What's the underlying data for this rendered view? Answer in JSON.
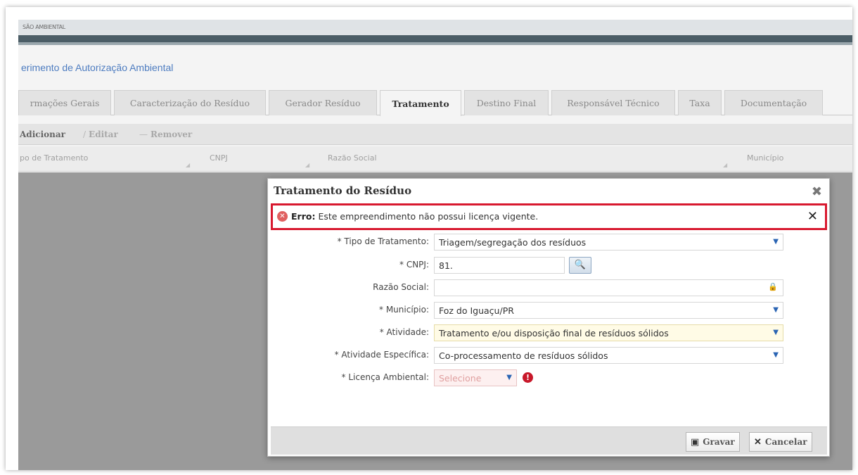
{
  "header": {
    "brand": "SÃO AMBIENTAL",
    "page_title": "erimento de Autorização Ambiental"
  },
  "tabs": [
    {
      "label": "rmações Gerais"
    },
    {
      "label": "Caracterização do Resíduo"
    },
    {
      "label": "Gerador Resíduo"
    },
    {
      "label": "Tratamento"
    },
    {
      "label": "Destino Final"
    },
    {
      "label": "Responsável Técnico"
    },
    {
      "label": "Taxa"
    },
    {
      "label": "Documentação"
    }
  ],
  "toolbar": {
    "add_label": "Adicionar",
    "edit_label": "Editar",
    "remove_label": "Remover"
  },
  "grid": {
    "columns": [
      "po de Tratamento",
      "CNPJ",
      "Razão Social",
      "Município"
    ]
  },
  "modal": {
    "title": "Tratamento do Resíduo",
    "error": {
      "prefix": "Erro:",
      "message": "Este empreendimento não possui licença vigente."
    },
    "fields": {
      "tipo_tratamento": {
        "label": "* Tipo de Tratamento:",
        "value": "Triagem/segregação dos resíduos"
      },
      "cnpj": {
        "label": "* CNPJ:",
        "value": "81."
      },
      "razao_social": {
        "label": "Razão Social:",
        "value": ""
      },
      "municipio": {
        "label": "* Município:",
        "value": "Foz do Iguaçu/PR"
      },
      "atividade": {
        "label": "* Atividade:",
        "value": "Tratamento e/ou disposição final de resíduos sólidos"
      },
      "atividade_especifica": {
        "label": "* Atividade Específica:",
        "value": "Co-processamento de resíduos sólidos"
      },
      "licenca": {
        "label": "* Licença Ambiental:",
        "value": "Selecione"
      }
    },
    "buttons": {
      "save_label": "Gravar",
      "cancel_label": "Cancelar"
    }
  }
}
